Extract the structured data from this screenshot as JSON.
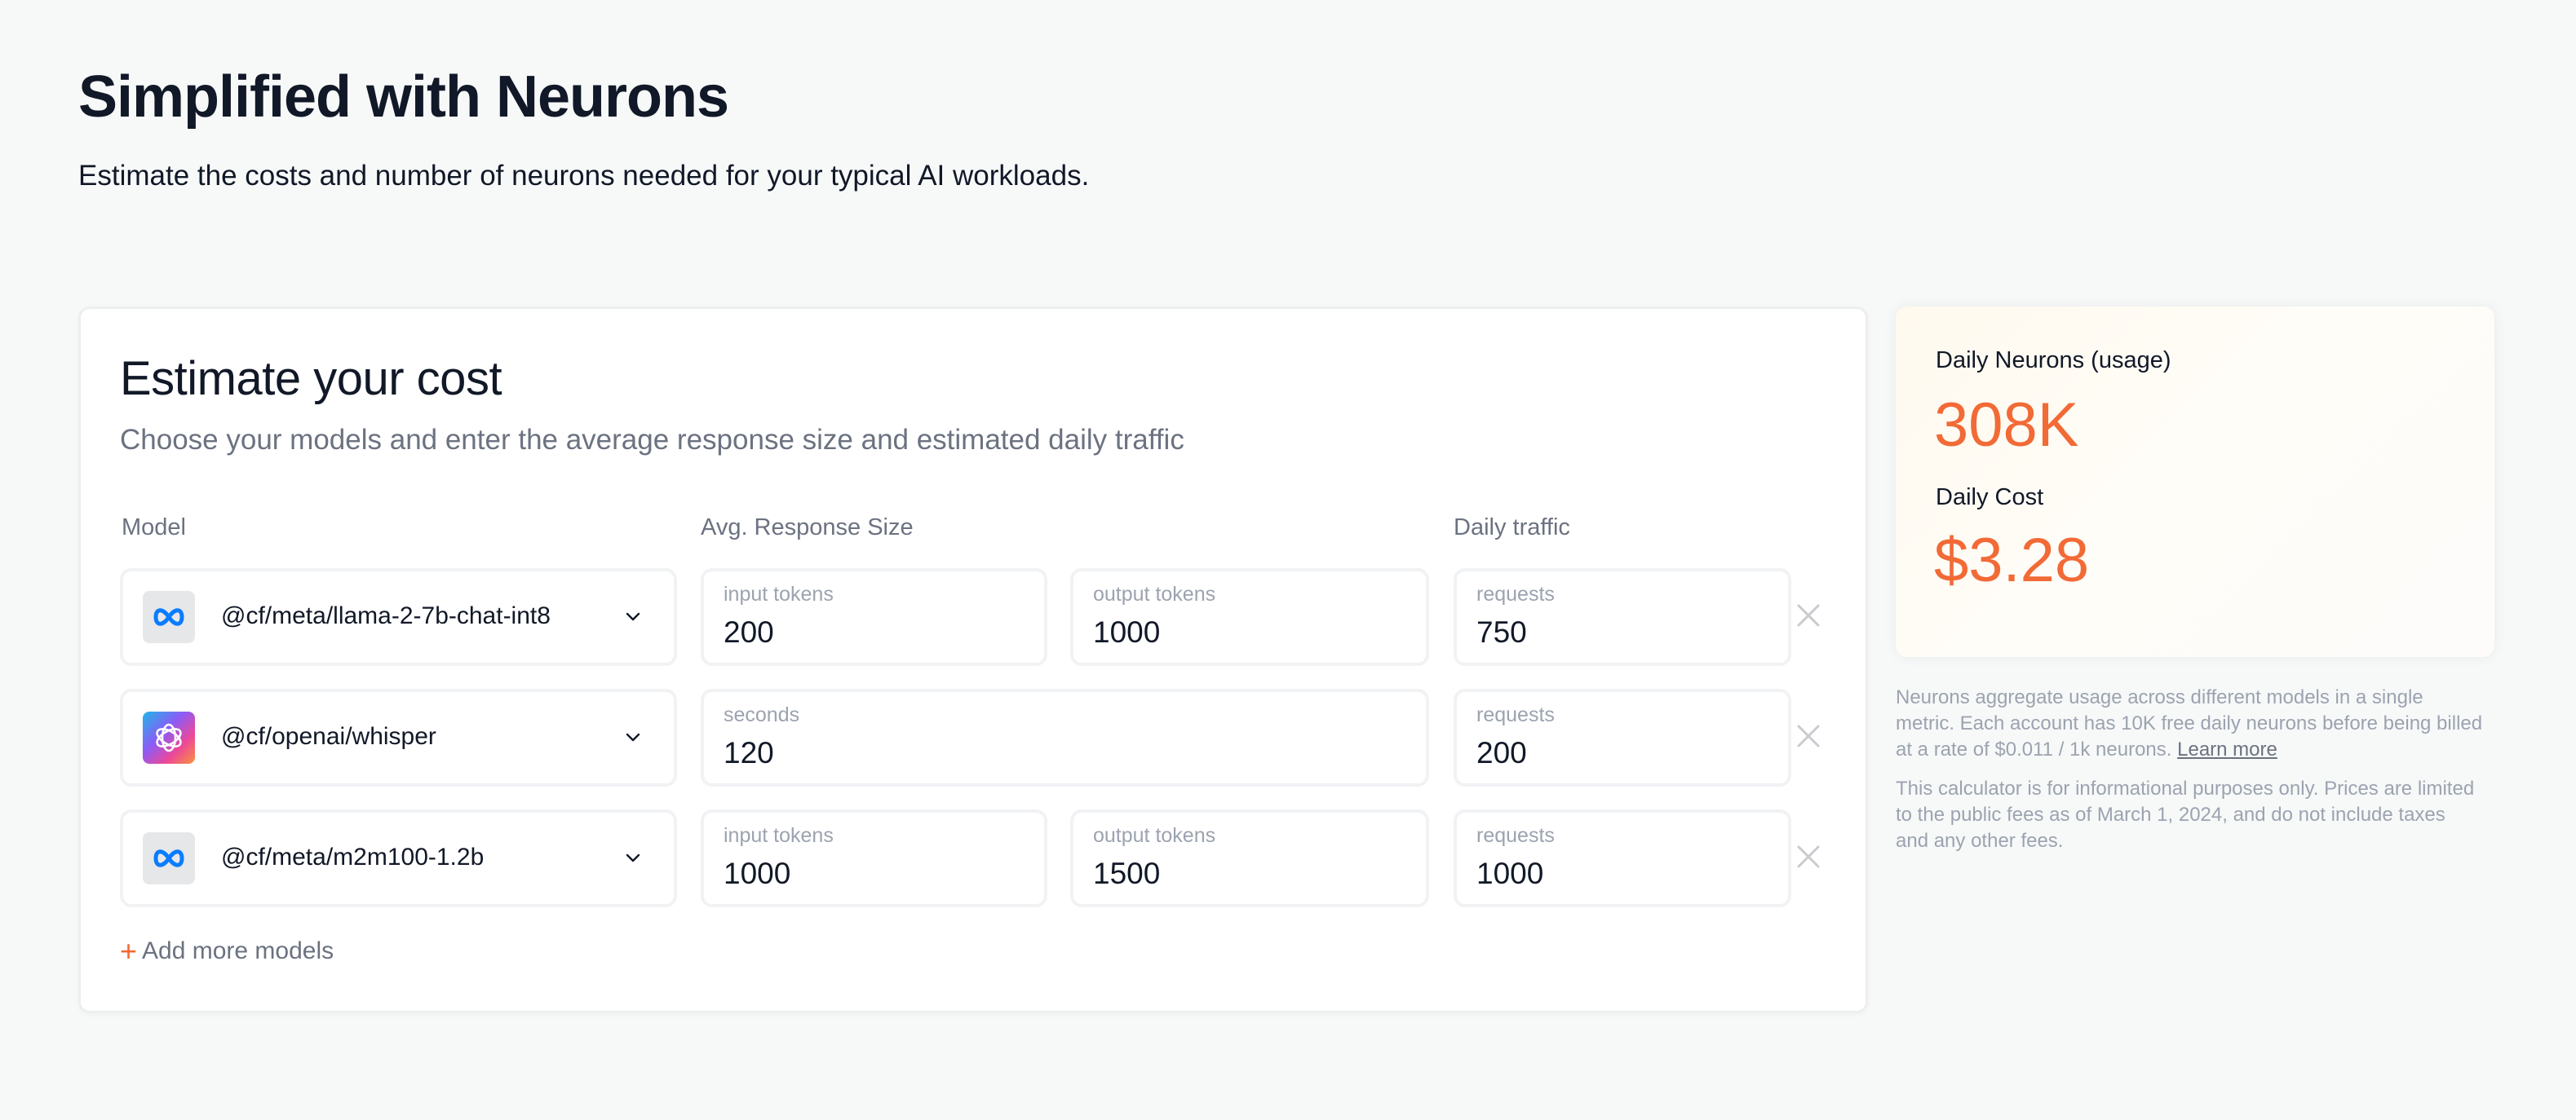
{
  "header": {
    "title": "Simplified with Neurons",
    "subtitle": "Estimate the costs and number of neurons needed for your typical AI workloads."
  },
  "calculator": {
    "title": "Estimate your cost",
    "subtitle": "Choose your models and enter the average response size and estimated daily traffic",
    "columns": {
      "model": "Model",
      "size": "Avg. Response Size",
      "traffic": "Daily traffic"
    },
    "rows": [
      {
        "model": "@cf/meta/llama-2-7b-chat-int8",
        "logo": "meta-logo-icon",
        "input_label": "input tokens",
        "input_value": "200",
        "output_label": "output tokens",
        "output_value": "1000",
        "requests_label": "requests",
        "requests_value": "750"
      },
      {
        "model": "@cf/openai/whisper",
        "logo": "openai-logo-icon",
        "seconds_label": "seconds",
        "seconds_value": "120",
        "requests_label": "requests",
        "requests_value": "200"
      },
      {
        "model": "@cf/meta/m2m100-1.2b",
        "logo": "meta-logo-icon",
        "input_label": "input tokens",
        "input_value": "1000",
        "output_label": "output tokens",
        "output_value": "1500",
        "requests_label": "requests",
        "requests_value": "1000"
      }
    ],
    "add_more_label": "Add more models",
    "add_more_icon": "+"
  },
  "summary": {
    "neurons_label": "Daily Neurons (usage)",
    "neurons_value": "308K",
    "cost_label": "Daily Cost",
    "cost_value": "$3.28",
    "accent_color": "#f26a36"
  },
  "notes": {
    "note1": "Neurons aggregate usage across different models in a single metric. Each account has 10K free daily neurons before being billed at a rate of $0.011 / 1k neurons.",
    "learn_more": "Learn more",
    "note2": "This calculator is for informational purposes only. Prices are limited to the public fees as of March 1, 2024, and do not include taxes and any other fees."
  }
}
